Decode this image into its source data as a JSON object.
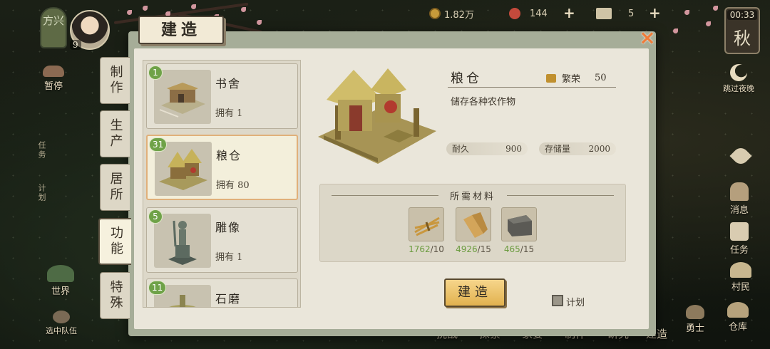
{
  "top_bar": {
    "faction": "方兴",
    "player_level": "9",
    "copper": "1.82万",
    "resource2": "144",
    "resource3": "5",
    "time": "00:33",
    "season": "秋"
  },
  "left_menu": {
    "pause": "暂停",
    "task_short": "任务",
    "plan_short": "计划",
    "world": "世界",
    "select_team": "选中队伍"
  },
  "right_menu": {
    "skip_night": "跳过夜晚",
    "message": "消息",
    "task": "任务",
    "villager": "村民",
    "warehouse": "仓库",
    "warrior": "勇士"
  },
  "bottom_nav": [
    "挑战",
    "探索",
    "家宴",
    "制作",
    "研究",
    "建造"
  ],
  "dialog": {
    "title": "建造",
    "close": "×",
    "categories": [
      "制作",
      "生产",
      "居所",
      "功能",
      "特殊"
    ],
    "active_category": "功能",
    "buildings": [
      {
        "level": "1",
        "name": "书舍",
        "owned": "拥有 1"
      },
      {
        "level": "31",
        "name": "粮仓",
        "owned": "拥有 80"
      },
      {
        "level": "5",
        "name": "雕像",
        "owned": "拥有 1"
      },
      {
        "level": "11",
        "name": "石磨",
        "owned": ""
      }
    ],
    "selected_index": 1,
    "detail": {
      "name": "粮仓",
      "prosperity_label": "繁荣",
      "prosperity_value": "50",
      "description": "储存各种农作物",
      "durability_label": "耐久",
      "durability_value": "900",
      "storage_label": "存储量",
      "storage_value": "2000"
    },
    "materials_title": "所需材料",
    "materials": [
      {
        "icon": "straw-icon",
        "have": "1762",
        "need": "/10"
      },
      {
        "icon": "wood-plank-icon",
        "have": "4926",
        "need": "/15"
      },
      {
        "icon": "stone-block-icon",
        "have": "465",
        "need": "/15"
      }
    ],
    "build_button": "建造",
    "plan_label": "计划"
  },
  "colors": {
    "accent_close": "#ef7c3a",
    "have_green": "#6b9b3f",
    "level_badge": "#6fa248",
    "build_button": "#e2b24f"
  }
}
